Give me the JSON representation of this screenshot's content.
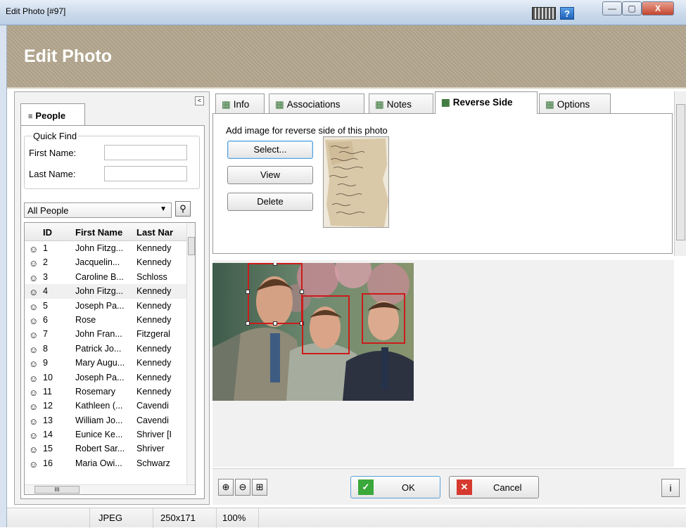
{
  "window": {
    "title": "Edit Photo [#97]",
    "help": "?",
    "minimize": "—",
    "maximize": "▢",
    "close": "X"
  },
  "header": {
    "title": "Edit Photo"
  },
  "left_panel": {
    "collapse": "<",
    "tab_label": "People",
    "quick_find": {
      "legend": "Quick Find",
      "first_name_label": "First Name:",
      "first_name_value": "",
      "last_name_label": "Last Name:",
      "last_name_value": ""
    },
    "filter": {
      "selected": "All People"
    },
    "grid": {
      "columns": [
        "ID",
        "First Name",
        "Last Nar"
      ],
      "rows": [
        {
          "id": "1",
          "first": "John Fitzg...",
          "last": "Kennedy"
        },
        {
          "id": "2",
          "first": "Jacquelin...",
          "last": "Kennedy"
        },
        {
          "id": "3",
          "first": "Caroline B...",
          "last": "Schloss"
        },
        {
          "id": "4",
          "first": "John Fitzg...",
          "last": "Kennedy"
        },
        {
          "id": "5",
          "first": "Joseph Pa...",
          "last": "Kennedy"
        },
        {
          "id": "6",
          "first": "Rose",
          "last": "Kennedy"
        },
        {
          "id": "7",
          "first": "John Fran...",
          "last": "Fitzgeral"
        },
        {
          "id": "8",
          "first": "Patrick Jo...",
          "last": "Kennedy"
        },
        {
          "id": "9",
          "first": "Mary Augu...",
          "last": "Kennedy"
        },
        {
          "id": "10",
          "first": "Joseph Pa...",
          "last": "Kennedy"
        },
        {
          "id": "11",
          "first": "Rosemary",
          "last": "Kennedy"
        },
        {
          "id": "12",
          "first": "Kathleen (...",
          "last": "Cavendi"
        },
        {
          "id": "13",
          "first": "William Jo...",
          "last": "Cavendi"
        },
        {
          "id": "14",
          "first": "Eunice Ke...",
          "last": "Shriver [I"
        },
        {
          "id": "15",
          "first": "Robert Sar...",
          "last": "Shriver"
        },
        {
          "id": "16",
          "first": "Maria Owi...",
          "last": "Schwarz"
        }
      ]
    },
    "hscroll_grip": "III"
  },
  "tabs": [
    {
      "label": "Info",
      "active": false
    },
    {
      "label": "Associations",
      "active": false
    },
    {
      "label": "Notes",
      "active": false
    },
    {
      "label": "Reverse Side",
      "active": true
    },
    {
      "label": "Options",
      "active": false
    }
  ],
  "reverse_side": {
    "instruction": "Add image for reverse side of this photo",
    "select_label": "Select...",
    "view_label": "View",
    "delete_label": "Delete"
  },
  "bottom": {
    "ok_label": "OK",
    "cancel_label": "Cancel",
    "info": "i"
  },
  "status": {
    "format": "JPEG",
    "dimensions": "250x171",
    "zoom": "100%"
  },
  "colors": {
    "banner": "#b3a78f",
    "face_box": "#cc1b1b",
    "ok_check": "#3aa83a",
    "cancel_x": "#d63a2f"
  }
}
